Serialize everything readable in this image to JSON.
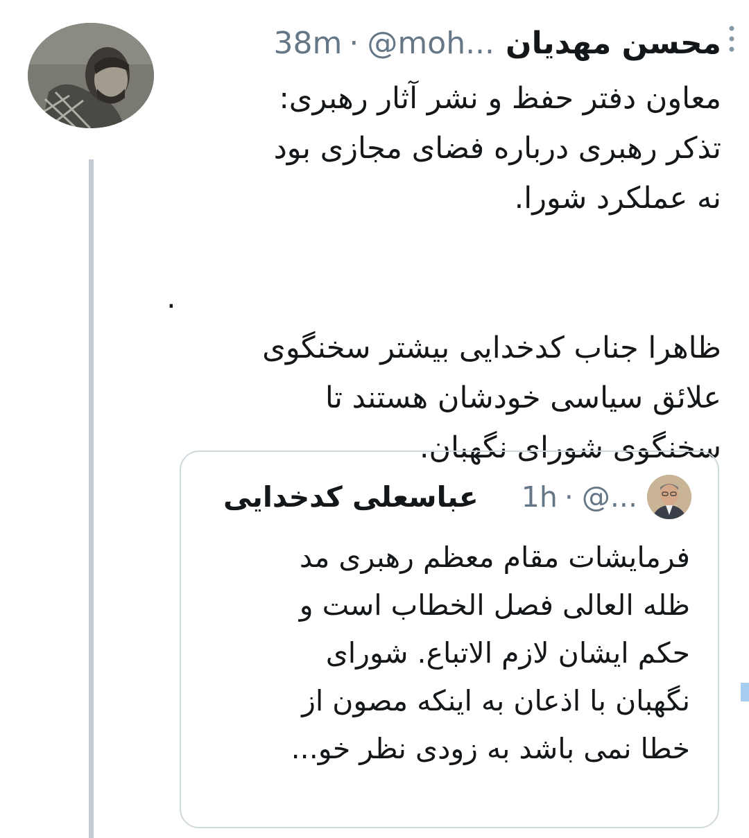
{
  "tweet": {
    "display_name": "محسن مهدیان",
    "handle": "@moh...",
    "separator": "·",
    "time": "38m",
    "more_icon": "vertical-dots-icon",
    "lines": [
      "معاون دفتر حفظ و نشر آثار رهبری:",
      "تذکر رهبری درباره فضای مجازی بود",
      "نه عملکرد شورا.",
      "",
      ".",
      "ظاهرا جناب کدخدایی بیشتر سخنگوی",
      "علائق سیاسی خودشان هستند تا",
      "سخنگوی شورای نگهبان."
    ]
  },
  "quoted_tweet": {
    "display_name": "عباسعلی کدخدایی",
    "handle": "@...",
    "separator": "·",
    "time": "1h",
    "lines": [
      "فرمایشات مقام معظم رهبری مد",
      "ظله العالی فصل الخطاب است و",
      "حکم ایشان لازم الاتباع. شورای",
      "نگهبان با اذعان به اینکه مصون از",
      "خطا نمی باشد به زودی نظر خو..."
    ]
  },
  "colors": {
    "text": "#14171a",
    "secondary": "#657786",
    "border": "#cfd9de",
    "thread_line": "#c6ccd3",
    "accent": "#a7cef0"
  }
}
